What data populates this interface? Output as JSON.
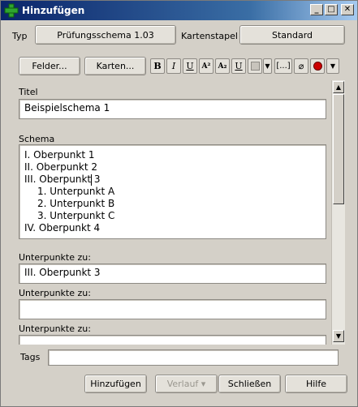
{
  "window": {
    "title": "Hinzufügen",
    "buttons": {
      "minimize": "_",
      "maximize": "□",
      "close": "✕"
    }
  },
  "header": {
    "type_label": "Typ",
    "type_value": "Prüfungsschema 1.03",
    "deck_label": "Kartenstapel",
    "deck_value": "Standard"
  },
  "toolbar": {
    "fields_label": "Felder...",
    "cards_label": "Karten...",
    "bold": "B",
    "italic": "I",
    "underline": "U",
    "superscript": "A²",
    "subscript": "A₂",
    "text_color": "U",
    "cloze": "[...]",
    "attach": "📎"
  },
  "fields": [
    {
      "label": "Titel",
      "value": "Beispielschema 1"
    },
    {
      "label": "Schema",
      "lines": [
        "I. Oberpunkt 1",
        "II. Oberpunkt 2",
        "III. Oberpunkt 3",
        "1. Unterpunkt A",
        "2. Unterpunkt B",
        "3. Unterpunkt C",
        "IV. Oberpunkt 4"
      ]
    },
    {
      "label": "Unterpunkte zu:",
      "value": "III. Oberpunkt 3"
    },
    {
      "label": "Unterpunkte zu:",
      "value": ""
    },
    {
      "label": "Unterpunkte zu:",
      "value": ""
    }
  ],
  "tags": {
    "label": "Tags",
    "value": ""
  },
  "footer": {
    "add_label": "Hinzufügen",
    "history_label": "Verlauf ▾",
    "close_label": "Schließen",
    "help_label": "Hilfe"
  },
  "colors": {
    "title_start": "#0a246a",
    "title_end": "#a6caf0",
    "record": "#cc0000",
    "color_swatch": "#c8c4bc"
  }
}
